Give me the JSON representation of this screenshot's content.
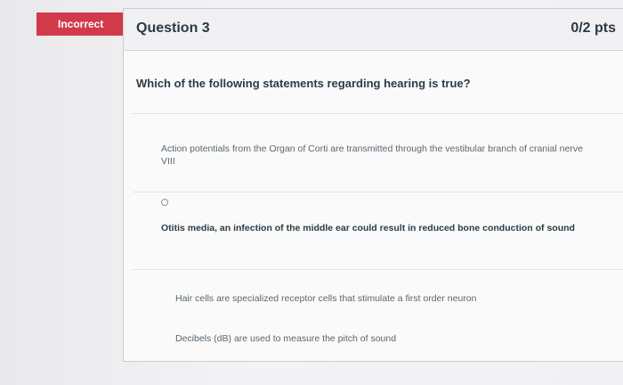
{
  "badge": {
    "label": "Incorrect"
  },
  "question": {
    "title": "Question 3",
    "points": "0/2 pts",
    "text": "Which of the following statements regarding hearing is true?",
    "answers": [
      {
        "label": "Action potentials from the Organ of Corti are transmitted through the vestibular branch of cranial nerve VIII",
        "selected": false
      },
      {
        "label": "Otitis media, an infection of the middle ear could result in reduced bone conduction of sound",
        "selected": true
      },
      {
        "label": "Hair cells are specialized receptor cells that stimulate a first order neuron",
        "selected": false
      },
      {
        "label": "Decibels (dB) are used to measure the pitch of sound",
        "selected": false
      }
    ]
  },
  "colors": {
    "incorrect": "#d23a4b",
    "text": "#2d3b45"
  }
}
